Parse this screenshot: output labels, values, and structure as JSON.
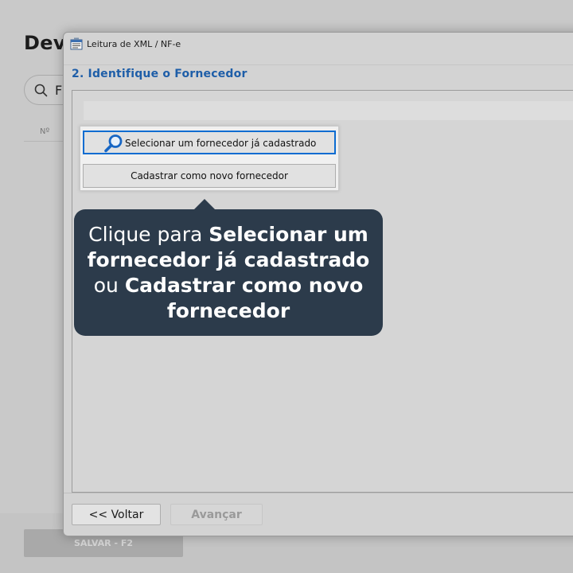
{
  "background": {
    "page_title": "Devo",
    "search_value": "F",
    "column_no": "Nº",
    "save_label": "SALVAR - F2"
  },
  "dialog": {
    "window_title": "Leitura de XML / NF-e",
    "step_heading": "2. Identifique o Fornecedor",
    "back_label": "<< Voltar",
    "next_label": "Avançar"
  },
  "menu": {
    "select_label": "Selecionar um fornecedor já cadastrado",
    "register_label": "Cadastrar como novo fornecedor"
  },
  "callout": {
    "part1": "Clique para ",
    "bold1": "Selecionar um fornecedor já cadastrado",
    "part2": " ou ",
    "bold2": "Cadastrar como novo fornecedor"
  },
  "colors": {
    "callout_bg": "#2c3b4b",
    "heading_blue": "#1e5ea8",
    "focus_blue": "#0b6cd1"
  },
  "icons": {
    "app": "xml-reader-app-icon",
    "select": "magnifier-icon",
    "search": "search-icon"
  }
}
